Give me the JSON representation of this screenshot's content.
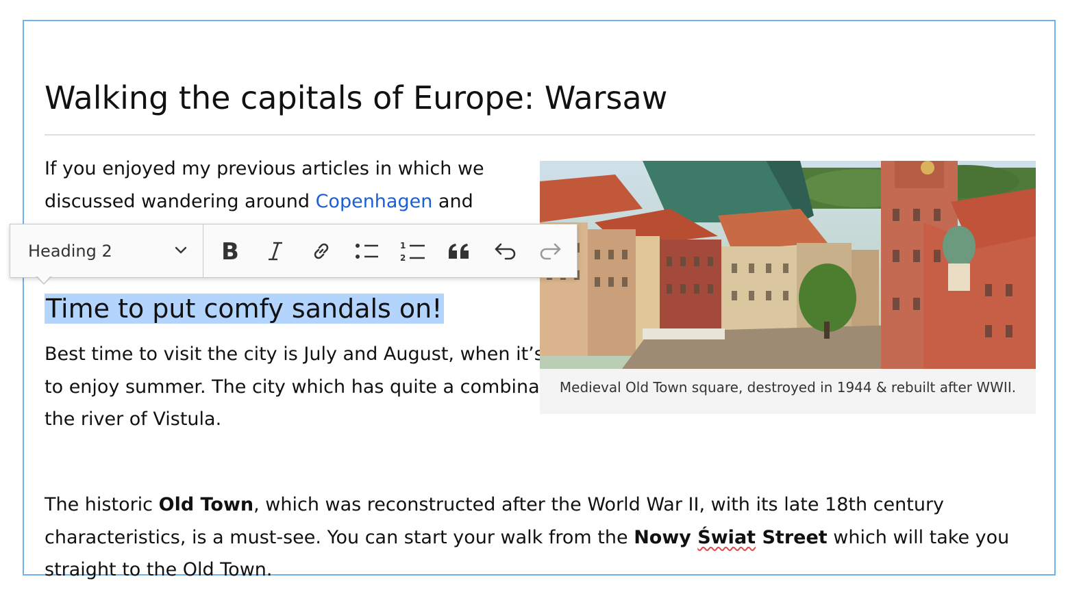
{
  "document": {
    "title": "Walking the capitals of Europe: Warsaw",
    "paragraph1": {
      "before": "If you enjoyed my previous articles in which we discussed wandering around ",
      "link": "Copenhagen",
      "after": " and"
    },
    "heading2": "Time to put comfy sandals on!",
    "paragraph2": "Best time to visit the city is July and August, when it’s cool enough to not break a sweat and hot enough to enjoy summer. The city which has quite a combination of both old and modern textures is located by the river of Vistula.",
    "paragraph3": {
      "t1": "The historic ",
      "b1": "Old Town",
      "t2": ", which was reconstructed after the World War II, with its late 18th century characteristics, is a must-see. You can start your walk from the ",
      "b2a": "Nowy ",
      "b2b": "Świat",
      "b2c": " Street",
      "t3": " which will take you straight to the Old Town."
    },
    "figure": {
      "caption": "Medieval Old Town square, destroyed in 1944 & rebuilt after WWII."
    }
  },
  "toolbar": {
    "heading_select": "Heading 2",
    "buttons": [
      {
        "name": "bold-button",
        "icon": "bold-icon"
      },
      {
        "name": "italic-button",
        "icon": "italic-icon"
      },
      {
        "name": "link-button",
        "icon": "link-icon"
      },
      {
        "name": "bulleted-list-button",
        "icon": "bulleted-list-icon"
      },
      {
        "name": "numbered-list-button",
        "icon": "numbered-list-icon"
      },
      {
        "name": "block-quote-button",
        "icon": "quote-icon"
      },
      {
        "name": "undo-button",
        "icon": "undo-icon"
      },
      {
        "name": "redo-button",
        "icon": "redo-icon",
        "disabled": true
      }
    ]
  },
  "colors": {
    "editor_border": "#6fb1ec",
    "link": "#1a5fd6",
    "selection": "#b3d4fc",
    "toolbar_bg": "#fafafa",
    "icon": "#333333",
    "icon_disabled": "#9a9a9a"
  }
}
